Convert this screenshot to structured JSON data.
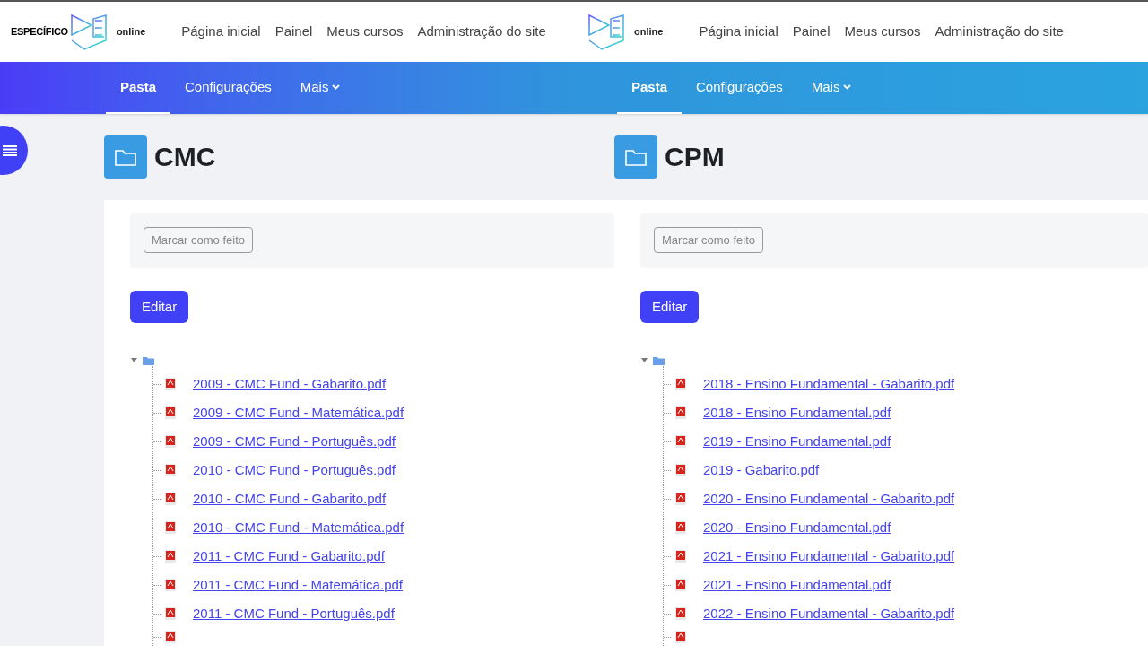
{
  "pages": [
    {
      "logo": {
        "brand": "ESPECÍFICO",
        "suffix": "online"
      },
      "nav": [
        "Página inicial",
        "Painel",
        "Meus cursos",
        "Administração do site"
      ],
      "tabs": [
        {
          "label": "Pasta",
          "selected": true
        },
        {
          "label": "Configurações",
          "selected": false
        },
        {
          "label": "Mais",
          "selected": false
        }
      ],
      "title": "CMC",
      "complete_button": "Marcar como feito",
      "edit_button": "Editar",
      "tree_expanded": true,
      "files": [
        "2009 - CMC Fund - Gabarito.pdf",
        "2009 - CMC Fund - Matemática.pdf",
        "2009 - CMC Fund - Português.pdf",
        "2010 - CMC Fund - Português.pdf",
        "2010 - CMC Fund - Gabarito.pdf",
        "2010 - CMC Fund - Matemática.pdf",
        "2011 - CMC Fund - Gabarito.pdf",
        "2011 - CMC Fund - Matemática.pdf",
        "2011 - CMC Fund - Português.pdf"
      ]
    },
    {
      "logo": {
        "suffix": "online"
      },
      "nav": [
        "Página inicial",
        "Painel",
        "Meus cursos",
        "Administração do site"
      ],
      "tabs": [
        {
          "label": "Pasta",
          "selected": true
        },
        {
          "label": "Configurações",
          "selected": false
        },
        {
          "label": "Mais",
          "selected": false
        }
      ],
      "title": "CPM",
      "complete_button": "Marcar como feito",
      "edit_button": "Editar",
      "tree_expanded": true,
      "files": [
        "2018 - Ensino Fundamental - Gabarito.pdf",
        "2018 - Ensino Fundamental.pdf",
        "2019 - Ensino Fundamental.pdf",
        "2019 - Gabarito.pdf",
        "2020 - Ensino Fundamental - Gabarito.pdf",
        "2020 - Ensino Fundamental.pdf",
        "2021 - Ensino Fundamental - Gabarito.pdf",
        "2021 - Ensino Fundamental.pdf",
        "2022 - Ensino Fundamental - Gabarito.pdf"
      ]
    }
  ]
}
